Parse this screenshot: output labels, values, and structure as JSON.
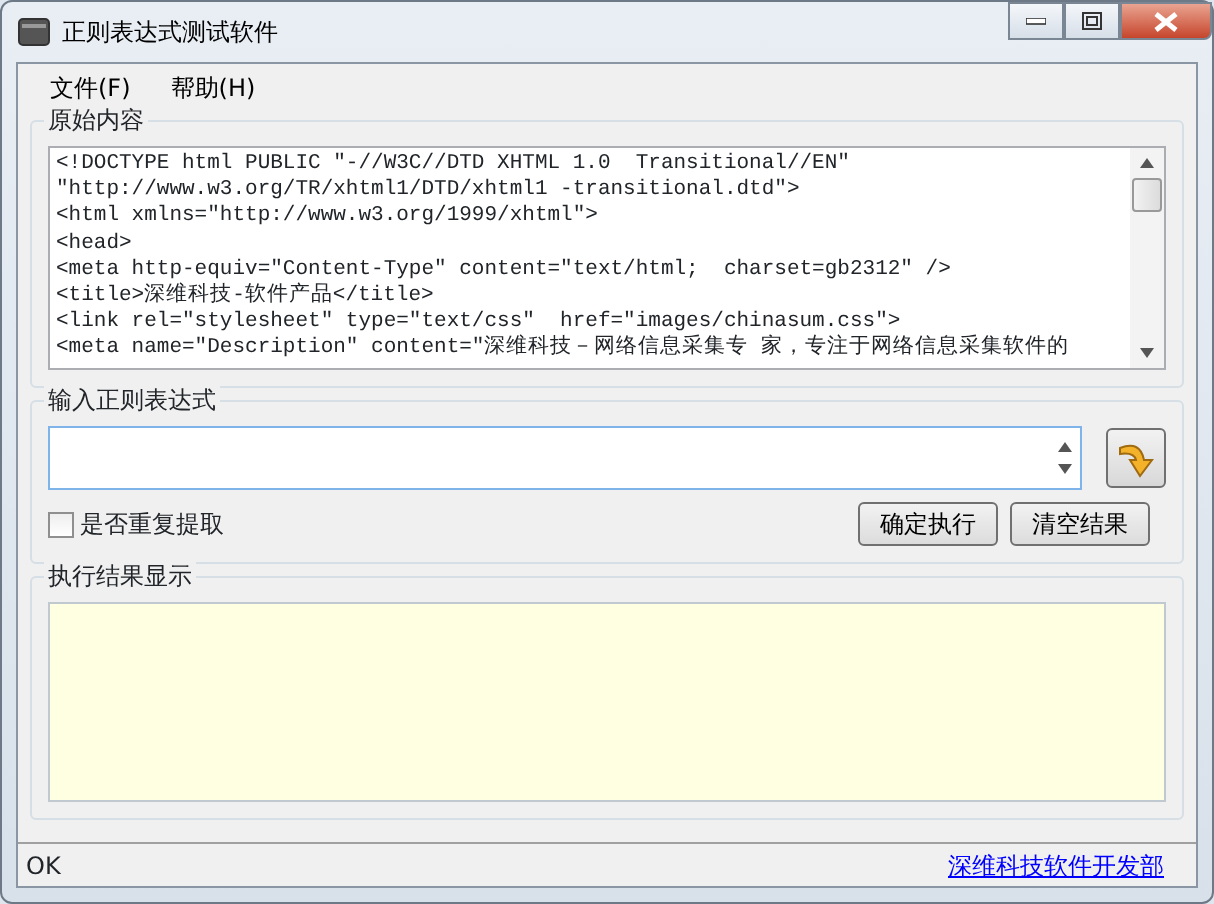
{
  "window": {
    "title": "正则表达式测试软件"
  },
  "menu": [
    {
      "label": "文件(F)"
    },
    {
      "label": "帮助(H)"
    }
  ],
  "source": {
    "title": "原始内容",
    "lines": [
      "<!DOCTYPE html PUBLIC \"-//W3C//DTD XHTML 1.0  Transitional//EN\"",
      "\"http://www.w3.org/TR/xhtml1/DTD/xhtml1 -transitional.dtd\">",
      "<html xmlns=\"http://www.w3.org/1999/xhtml\">",
      "<head>",
      "<meta http-equiv=\"Content-Type\" content=\"text/html;  charset=gb2312\" />",
      "<title>深维科技-软件产品</title>",
      "<link rel=\"stylesheet\" type=\"text/css\"  href=\"images/chinasum.css\">",
      "<meta name=\"Description\" content=\"深维科技－网络信息采集专 家，专注于网络信息采集软件的"
    ]
  },
  "regex": {
    "title": "输入正则表达式",
    "repeat": {
      "label": "是否重复提取",
      "checked": false
    },
    "buttons": [
      "确定执行",
      "清空结果"
    ]
  },
  "result": {
    "title": "执行结果显示"
  },
  "status_bar": {
    "text": "OK",
    "link": "深维科技软件开发部"
  }
}
